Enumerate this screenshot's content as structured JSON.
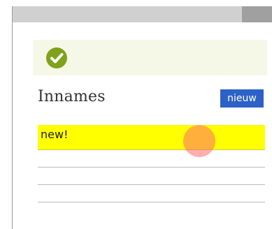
{
  "notice": {
    "icon": "check-circle-icon",
    "icon_color": "#7fa21a"
  },
  "section": {
    "title": "Innames"
  },
  "toolbar": {
    "new_label": "nieuw",
    "new_color": "#2c62c8"
  },
  "list": {
    "rows": [
      {
        "label": "new!",
        "highlighted": true
      },
      {
        "label": ""
      },
      {
        "label": ""
      },
      {
        "label": ""
      }
    ]
  }
}
